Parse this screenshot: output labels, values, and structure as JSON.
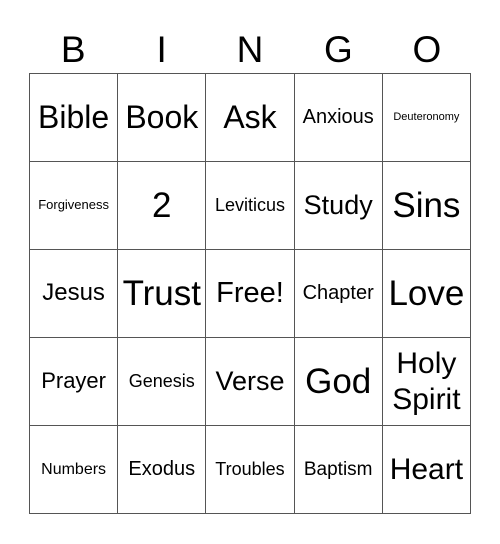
{
  "header": [
    "B",
    "I",
    "N",
    "G",
    "O"
  ],
  "cells": [
    [
      "Bible",
      "Book",
      "Ask",
      "Anxious",
      "Deuteronomy"
    ],
    [
      "Forgiveness",
      "2",
      "Leviticus",
      "Study",
      "Sins"
    ],
    [
      "Jesus",
      "Trust",
      "Free!",
      "Chapter",
      "Love"
    ],
    [
      "Prayer",
      "Genesis",
      "Verse",
      "God",
      "Holy Spirit"
    ],
    [
      "Numbers",
      "Exodus",
      "Troubles",
      "Baptism",
      "Heart"
    ]
  ]
}
